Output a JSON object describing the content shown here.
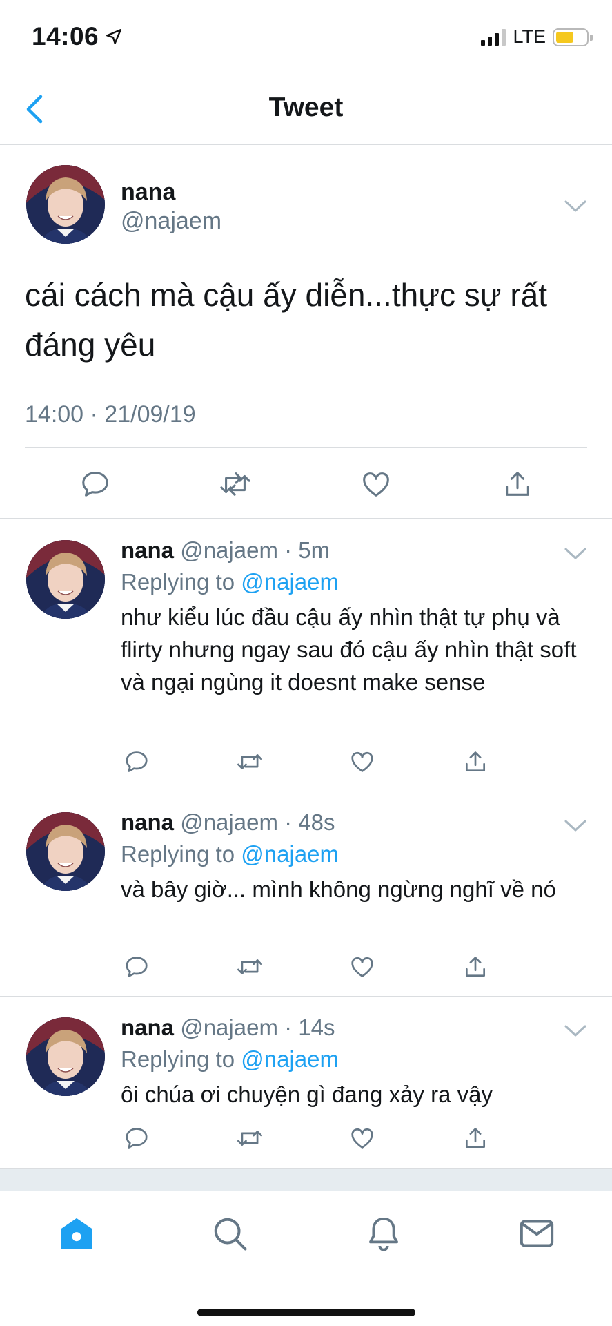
{
  "status_bar": {
    "time": "14:06",
    "network": "LTE"
  },
  "nav": {
    "title": "Tweet"
  },
  "main_tweet": {
    "name": "nana",
    "handle": "@najaem",
    "text": "cái cách mà cậu ấy diễn...thực sự rất đáng yêu",
    "timestamp": "14:00 · 21/09/19"
  },
  "replies": [
    {
      "name": "nana",
      "handle": "@najaem",
      "time": "5m",
      "replying_label": "Replying to",
      "replying_to": "@najaem",
      "text": "như kiểu lúc đầu cậu ấy nhìn thật tự phụ và flirty nhưng ngay sau đó cậu ấy nhìn thật soft và ngại ngùng it doesnt make sense"
    },
    {
      "name": "nana",
      "handle": "@najaem",
      "time": "48s",
      "replying_label": "Replying to",
      "replying_to": "@najaem",
      "text": "và bây giờ... mình không ngừng nghĩ về nó"
    },
    {
      "name": "nana",
      "handle": "@najaem",
      "time": "14s",
      "replying_label": "Replying to",
      "replying_to": "@najaem",
      "text": "ôi chúa ơi chuyện gì đang xảy ra vậy"
    }
  ],
  "icons": {
    "back": "chevron-left-icon",
    "caret": "chevron-down-icon",
    "reply": "comment-icon",
    "retweet": "retweet-icon",
    "like": "heart-icon",
    "share": "share-icon",
    "tab_home": "home-icon",
    "tab_search": "search-icon",
    "tab_notifications": "bell-icon",
    "tab_messages": "mail-icon"
  },
  "colors": {
    "accent": "#1da1f2",
    "secondary_text": "#657786",
    "divider": "#dadde0",
    "battery": "#f5c81f"
  }
}
